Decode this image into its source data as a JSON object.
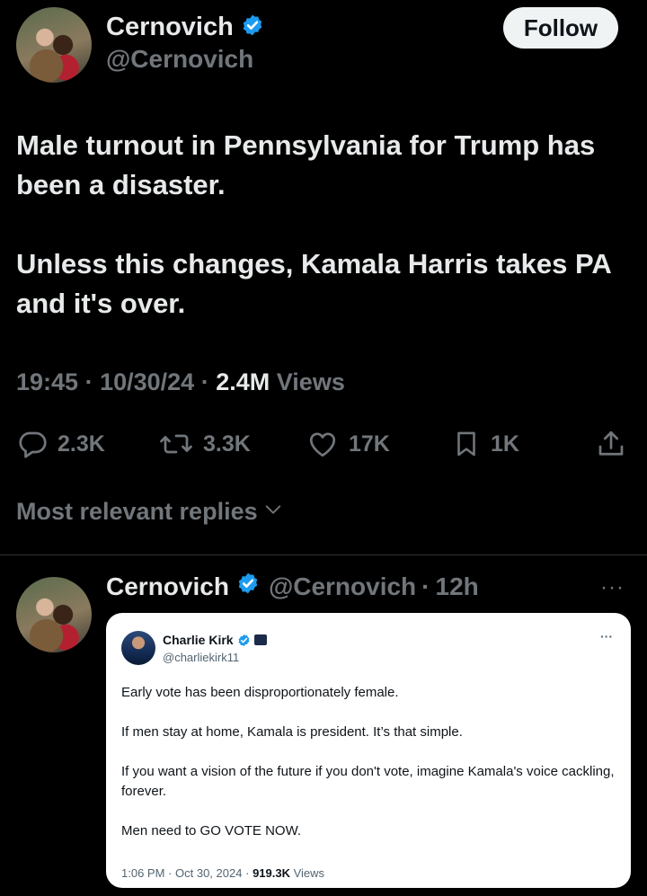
{
  "tweet": {
    "author_name": "Cernovich",
    "author_handle": "@Cernovich",
    "follow_label": "Follow",
    "text_paragraphs": [
      "Male turnout in Pennsylvania for Trump has been a disaster.",
      "Unless this changes, Kamala Harris takes PA and it's over."
    ],
    "time": "19:45",
    "date": "10/30/24",
    "views_count": "2.4M",
    "views_label": "Views",
    "separator": "·",
    "stats": {
      "replies": "2.3K",
      "reposts": "3.3K",
      "likes": "17K",
      "bookmarks": "1K"
    }
  },
  "replies_sort": {
    "label": "Most relevant replies"
  },
  "reply": {
    "author_name": "Cernovich",
    "author_handle": "@Cernovich",
    "separator": "·",
    "age": "12h",
    "more": "···"
  },
  "quoted_tweet": {
    "author_name": "Charlie Kirk",
    "author_handle": "@charliekirk11",
    "more": "···",
    "paragraphs": [
      "Early vote has been disproportionately female.",
      "If men stay at home, Kamala is president. It’s that simple.",
      "If you want a vision of the future if you don't vote, imagine Kamala's voice cackling, forever.",
      "Men need to GO VOTE NOW."
    ],
    "time": "1:06 PM",
    "date": "Oct 30, 2024",
    "views_count": "919.3K",
    "views_label": "Views",
    "separator": "·"
  },
  "colors": {
    "background": "#000000",
    "text": "#e7e9ea",
    "muted": "#71767b",
    "verified": "#1d9bf0",
    "follow_bg": "#eff3f4"
  },
  "icons": [
    "verified-badge-icon",
    "reply-icon",
    "repost-icon",
    "like-icon",
    "bookmark-icon",
    "share-icon",
    "chevron-down-icon",
    "affiliate-badge-icon"
  ]
}
